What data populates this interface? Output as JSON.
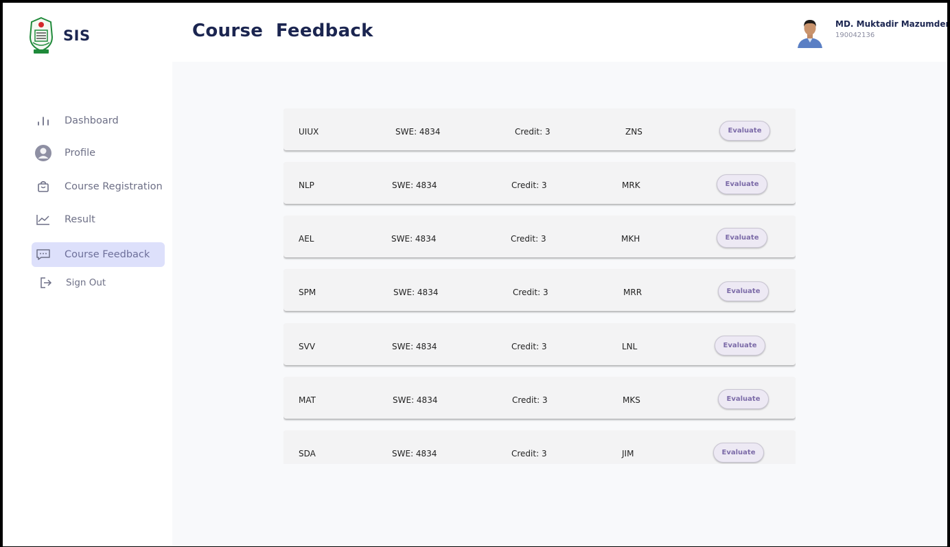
{
  "app": {
    "brand": "SIS"
  },
  "header": {
    "title": "Course  Feedback"
  },
  "user": {
    "name": "MD. Muktadir Mazumder",
    "id": "190042136"
  },
  "sidebar": {
    "items": [
      {
        "label": "Dashboard",
        "icon": "bar-chart-icon"
      },
      {
        "label": "Profile",
        "icon": "user-circle-icon"
      },
      {
        "label": "Course Registration",
        "icon": "bag-icon"
      },
      {
        "label": "Result",
        "icon": "line-chart-icon"
      },
      {
        "label": "Course Feedback",
        "icon": "message-icon",
        "active": true
      },
      {
        "label": "Sign Out",
        "icon": "sign-out-icon"
      }
    ]
  },
  "courses": [
    {
      "code": "UIUX",
      "number": "SWE: 4834",
      "credit": "Credit: 3",
      "teacher": "ZNS",
      "action": "Evaluate"
    },
    {
      "code": "NLP",
      "number": "SWE: 4834",
      "credit": "Credit: 3",
      "teacher": "MRK",
      "action": "Evaluate"
    },
    {
      "code": "AEL",
      "number": "SWE: 4834",
      "credit": "Credit: 3",
      "teacher": "MKH",
      "action": "Evaluate"
    },
    {
      "code": "SPM",
      "number": "SWE: 4834",
      "credit": "Credit: 3",
      "teacher": "MRR",
      "action": "Evaluate"
    },
    {
      "code": "SVV",
      "number": "SWE: 4834",
      "credit": "Credit: 3",
      "teacher": "LNL",
      "action": "Evaluate"
    },
    {
      "code": "MAT",
      "number": "SWE: 4834",
      "credit": "Credit: 3",
      "teacher": "MKS",
      "action": "Evaluate"
    },
    {
      "code": "SDA",
      "number": "SWE: 4834",
      "credit": "Credit: 3",
      "teacher": "JIM",
      "action": "Evaluate"
    }
  ],
  "colors": {
    "accent": "#dde0fb",
    "title": "#1b2550",
    "button_text": "#7c6ba8"
  }
}
